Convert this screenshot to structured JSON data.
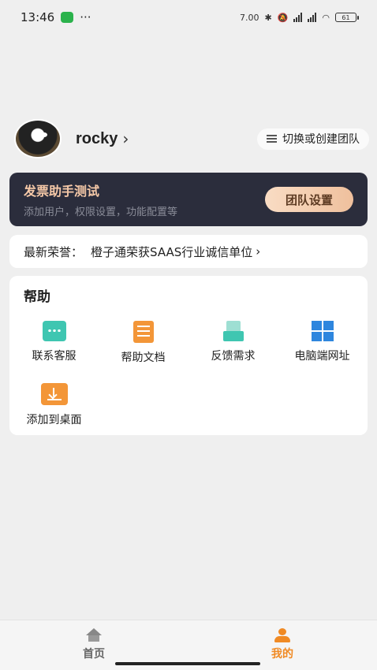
{
  "status_bar": {
    "time": "13:46",
    "more": "···",
    "network_speed": "7.00 KB/s",
    "battery": "61"
  },
  "profile": {
    "username": "rocky",
    "switch_team_label": "切换或创建团队"
  },
  "team_card": {
    "name": "发票助手测试",
    "description": "添加用户，权限设置，功能配置等",
    "settings_button": "团队设置"
  },
  "honor": {
    "label": "最新荣誉：",
    "text": "橙子通荣获SAAS行业诚信单位",
    "chevron": "›"
  },
  "help": {
    "title": "帮助",
    "items": [
      {
        "label": "联系客服",
        "icon": "customer-service-icon"
      },
      {
        "label": "帮助文档",
        "icon": "help-document-icon"
      },
      {
        "label": "反馈需求",
        "icon": "feedback-icon"
      },
      {
        "label": "电脑端网址",
        "icon": "windows-icon"
      },
      {
        "label": "添加到桌面",
        "icon": "add-to-desktop-icon"
      }
    ]
  },
  "tabbar": {
    "tabs": [
      {
        "label": "首页",
        "icon": "home-icon",
        "active": false
      },
      {
        "label": "我的",
        "icon": "user-icon",
        "active": true
      }
    ]
  },
  "colors": {
    "accent": "#f08a24",
    "team_card_bg": "#2b2d3c",
    "team_name": "#f6c9a8"
  }
}
